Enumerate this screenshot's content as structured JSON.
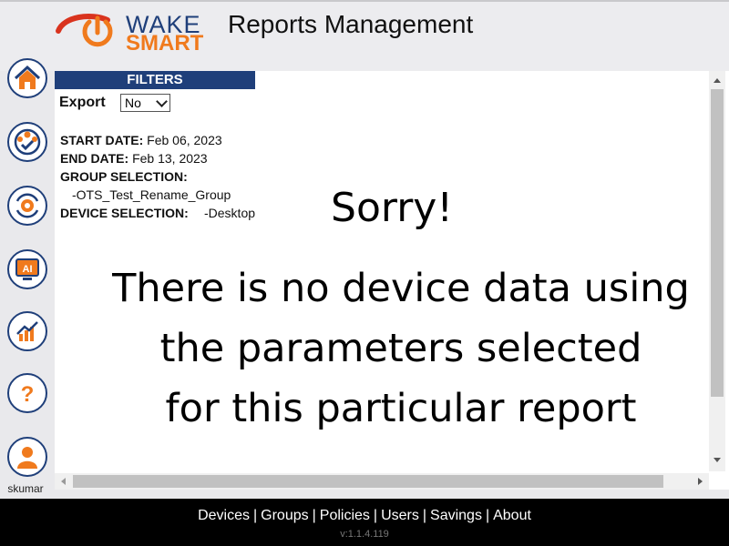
{
  "header": {
    "logo_wake": "WAKE",
    "logo_smart": "SMART",
    "title": "Reports Management"
  },
  "sidebar": {
    "items": [
      {
        "icon": "home-icon"
      },
      {
        "icon": "users-group-icon"
      },
      {
        "icon": "policy-gear-icon"
      },
      {
        "icon": "ai-monitor-icon"
      },
      {
        "icon": "savings-chart-icon"
      },
      {
        "icon": "help-icon"
      },
      {
        "icon": "user-profile-icon"
      }
    ],
    "username": "skumar"
  },
  "filters": {
    "heading": "FILTERS",
    "export_label": "Export",
    "export_value": "No",
    "start_label": "START DATE:",
    "start_value": "Feb 06, 2023",
    "end_label": "END DATE:",
    "end_value": "Feb 13, 2023",
    "group_label": "GROUP SELECTION:",
    "group_value": "-OTS_Test_Rename_Group",
    "device_label": "DEVICE SELECTION:",
    "device_value": "-Desktop"
  },
  "message": {
    "title": "Sorry!",
    "line1": "There is no device data using",
    "line2": "the parameters selected",
    "line3": "for this particular report"
  },
  "footer": {
    "links": [
      "Devices",
      "Groups",
      "Policies",
      "Users",
      "Savings",
      "About"
    ],
    "version": "v:1.1.4.119"
  },
  "colors": {
    "brand_blue": "#1f3f7a",
    "brand_orange": "#f07a1d",
    "logo_red": "#d9331e"
  }
}
